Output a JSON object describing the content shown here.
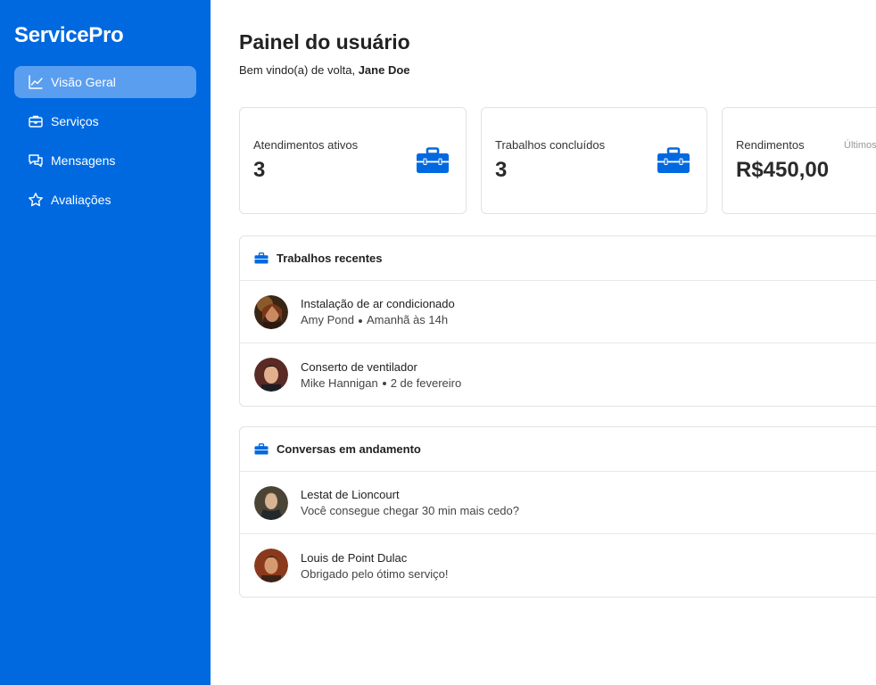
{
  "app": {
    "brand": "ServicePro"
  },
  "sidebar": {
    "items": [
      {
        "label": "Visão Geral",
        "icon": "chart-line-icon",
        "active": true
      },
      {
        "label": "Serviços",
        "icon": "briefcase-icon"
      },
      {
        "label": "Mensagens",
        "icon": "chat-bubbles-icon"
      },
      {
        "label": "Avaliações",
        "icon": "star-icon"
      }
    ]
  },
  "header": {
    "title": "Painel do usuário",
    "welcome_prefix": "Bem vindo(a) de volta,",
    "user_name": "Jane Doe"
  },
  "stats": [
    {
      "label": "Atendimentos ativos",
      "value": "3",
      "icon": "briefcase-icon"
    },
    {
      "label": "Trabalhos concluídos",
      "value": "3",
      "icon": "briefcase-icon"
    },
    {
      "label": "Rendimentos",
      "value": "R$450,00",
      "note": "Últimos"
    }
  ],
  "recent_jobs": {
    "title": "Trabalhos recentes",
    "items": [
      {
        "title": "Instalação de ar condicionado",
        "client": "Amy Pond",
        "when": "Amanhã às 14h"
      },
      {
        "title": "Conserto de ventilador",
        "client": "Mike Hannigan",
        "when": "2 de fevereiro"
      }
    ]
  },
  "conversations": {
    "title": "Conversas em andamento",
    "items": [
      {
        "name": "Lestat de Lioncourt",
        "message": "Você consegue chegar 30 min mais cedo?"
      },
      {
        "name": "Louis de Point Dulac",
        "message": "Obrigado pelo ótimo serviço!"
      }
    ]
  },
  "colors": {
    "primary": "#0069e0",
    "active_nav": "#5a9ef0",
    "border": "#e2e2e2"
  }
}
